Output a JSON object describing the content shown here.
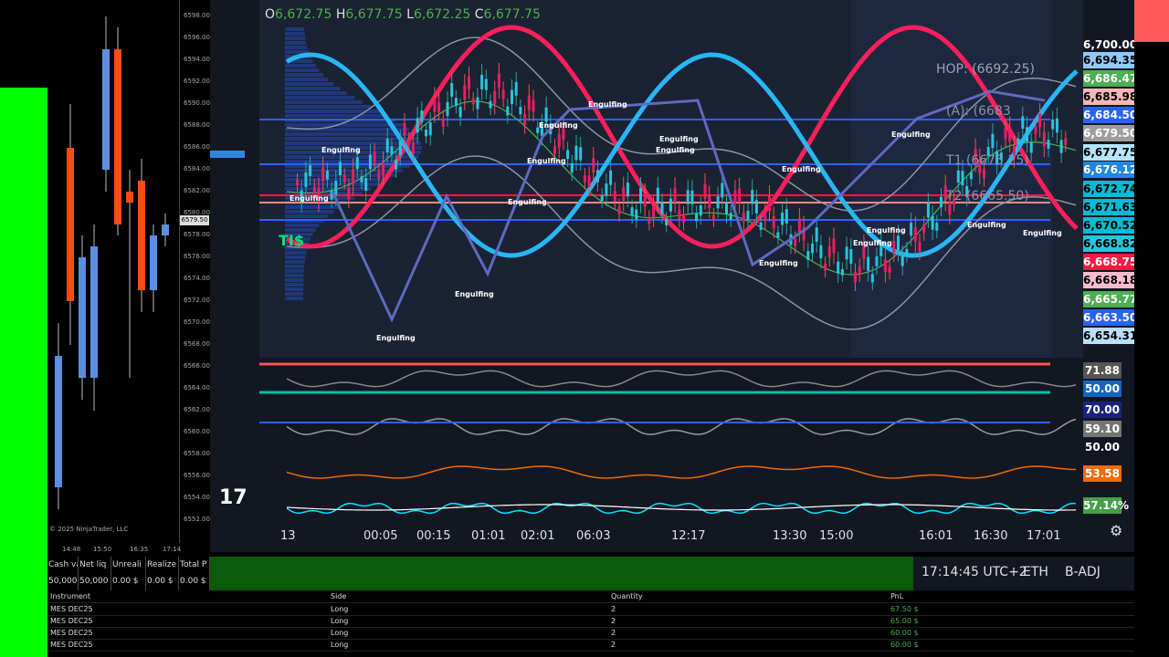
{
  "ninjatrader": {
    "price_ticks": [
      "6598.00",
      "6596.00",
      "6594.00",
      "6592.00",
      "6590.00",
      "6588.00",
      "6586.00",
      "6584.00",
      "6582.00",
      "6580.00",
      "6578.00",
      "6576.00",
      "6574.00",
      "6572.00",
      "6570.00",
      "6568.00",
      "6566.00",
      "6564.00",
      "6562.00",
      "6560.00",
      "6558.00",
      "6556.00",
      "6554.00",
      "6552.00"
    ],
    "current_price": "6579.50",
    "time_labels": [
      "14:48",
      "15:50",
      "16:35",
      "17:14"
    ],
    "copyright": "© 2025 NinjaTrader, LLC",
    "account": {
      "headers": [
        "Cash va",
        "Net liq",
        "Unreali",
        "Realize",
        "Total P"
      ],
      "values": [
        "50,000",
        "50,000",
        "0.00 $",
        "0.00 $",
        "0.00 $"
      ]
    },
    "candles": [
      {
        "o": 6567,
        "c": 6555,
        "h": 6570,
        "l": 6553,
        "dir": "up"
      },
      {
        "o": 6586,
        "c": 6572,
        "h": 6590,
        "l": 6568,
        "dir": "down"
      },
      {
        "o": 6565,
        "c": 6576,
        "h": 6578,
        "l": 6563,
        "dir": "up"
      },
      {
        "o": 6565,
        "c": 6577,
        "h": 6579,
        "l": 6562,
        "dir": "up"
      },
      {
        "o": 6584,
        "c": 6595,
        "h": 6598,
        "l": 6582,
        "dir": "up"
      },
      {
        "o": 6595,
        "c": 6579,
        "h": 6597,
        "l": 6578,
        "dir": "down"
      },
      {
        "o": 6582,
        "c": 6581,
        "h": 6584,
        "l": 6565,
        "dir": "down"
      },
      {
        "o": 6583,
        "c": 6573,
        "h": 6585,
        "l": 6571,
        "dir": "down"
      },
      {
        "o": 6573,
        "c": 6578,
        "h": 6579,
        "l": 6571,
        "dir": "up"
      },
      {
        "o": 6578,
        "c": 6579,
        "h": 6580,
        "l": 6577,
        "dir": "up"
      }
    ]
  },
  "tradingview": {
    "ohlc": {
      "o_label": "O",
      "o": "6,672.75",
      "h_label": "H",
      "h": "6,677.75",
      "l_label": "L",
      "l": "6,672.25",
      "c_label": "C",
      "c": "6,677.75"
    },
    "price_labels": [
      {
        "text": "6,700.00",
        "bg": "transparent",
        "fg": "#ffffff"
      },
      {
        "text": "6,694.35",
        "bg": "#90caf9",
        "fg": "#000000"
      },
      {
        "text": "6,686.47",
        "bg": "#4caf50",
        "fg": "#ffffff"
      },
      {
        "text": "6,685.98",
        "bg": "#f4b6b6",
        "fg": "#000000"
      },
      {
        "text": "6,684.50",
        "bg": "#2962ff",
        "fg": "#ffffff"
      },
      {
        "text": "6,679.50",
        "bg": "#9e9e9e",
        "fg": "#ffffff"
      },
      {
        "text": "6,677.75",
        "bg": "#b3e5fc",
        "fg": "#000000"
      },
      {
        "text": "6,676.12",
        "bg": "#1e88e5",
        "fg": "#ffffff"
      },
      {
        "text": "6,672.74",
        "bg": "#00bcd4",
        "fg": "#000000"
      },
      {
        "text": "6,671.63",
        "bg": "#00bcd4",
        "fg": "#000000"
      },
      {
        "text": "6,670.52",
        "bg": "#00bcd4",
        "fg": "#000000"
      },
      {
        "text": "6,668.82",
        "bg": "#26c6da",
        "fg": "#000000"
      },
      {
        "text": "6,668.75",
        "bg": "#ff1744",
        "fg": "#ffffff"
      },
      {
        "text": "6,668.18",
        "bg": "#f8bbd0",
        "fg": "#000000"
      },
      {
        "text": "6,665.77",
        "bg": "#4caf50",
        "fg": "#ffffff"
      },
      {
        "text": "6,663.50",
        "bg": "#2962ff",
        "fg": "#ffffff"
      },
      {
        "text": "6,654.31",
        "bg": "#bbdefb",
        "fg": "#000000"
      }
    ],
    "indicator_labels": [
      {
        "text": "71.88",
        "bg": "#555555"
      },
      {
        "text": "50.00",
        "bg": "#1565c0"
      },
      {
        "text": "70.00",
        "bg": "#1a237e"
      },
      {
        "text": "59.10",
        "bg": "#757575"
      },
      {
        "text": "50.00",
        "bg": "#131722"
      },
      {
        "text": "53.58",
        "bg": "#ef6c00"
      },
      {
        "text": "57.14%",
        "bg": "#43a047"
      }
    ],
    "time_labels": [
      "13",
      "00:05",
      "00:15",
      "01:01",
      "02:01",
      "06:03",
      "12:17",
      "13:30",
      "15:00",
      "16:01",
      "16:30",
      "17:01"
    ],
    "annotations": {
      "hop": "HOP: (6692.25)",
      "t1": "T1 (6675.25)",
      "t2": "T2 (6665.50)",
      "a": "(A): (6683",
      "tis": "TI$",
      "engulfing": "Engulfing"
    },
    "logo": "17"
  },
  "status_bar": {
    "clock": "17:14:45 UTC+2",
    "session": "ETH",
    "adjust": "B-ADJ"
  },
  "orders": {
    "headers": [
      "Instrument",
      "Side",
      "Quantity",
      "PnL"
    ],
    "rows": [
      [
        "MES DEC25",
        "Long",
        "2",
        "67.50 $"
      ],
      [
        "MES DEC25",
        "Long",
        "2",
        "65.00 $"
      ],
      [
        "MES DEC25",
        "Long",
        "2",
        "60.00 $"
      ],
      [
        "MES DEC25",
        "Long",
        "2",
        "60.00 $"
      ]
    ]
  }
}
